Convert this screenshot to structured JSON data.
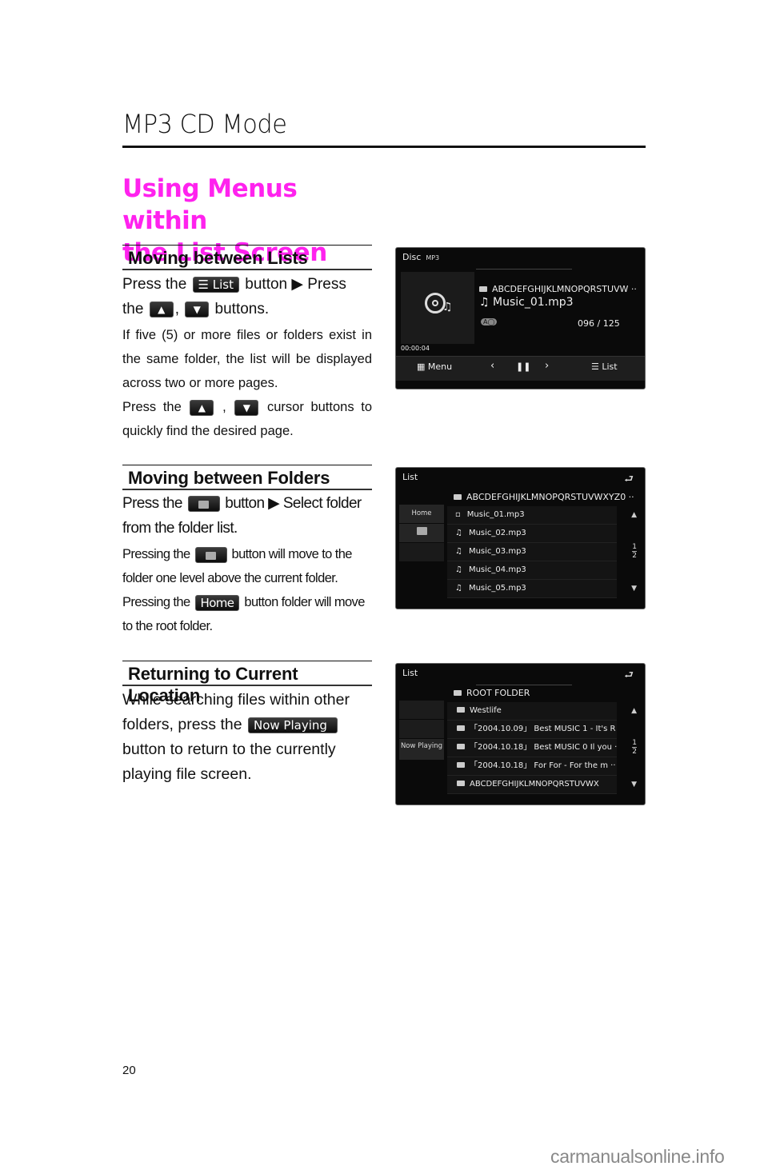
{
  "header": {
    "chapter_title": "MP3 CD Mode",
    "section_title_line1": "Using Menus within",
    "section_title_line2": "the List Screen"
  },
  "colors": {
    "section_title": "#ff22ee",
    "text": "#111111",
    "screen_bg": "#0a0a0a"
  },
  "sections": [
    {
      "heading": "Moving between Lists",
      "line1_pre": "Press the",
      "line1_button": "List",
      "line1_post": "button ▶ Press",
      "line2_pre": "the",
      "up_button": "▲",
      "down_button": "▼",
      "line2_post": "buttons.",
      "para1": "If five (5) or more files or folders exist in the same folder, the list will be displayed across two or more pages.",
      "para2_pre": "Press the",
      "para2_post": "cursor buttons to quickly find the desired page."
    },
    {
      "heading": "Moving between Folders",
      "line1_pre": "Press the",
      "line1_post": "button ▶ Select folder from the folder list.",
      "para1_pre": "Pressing the",
      "para1_post": "button will move to the folder one level above the current folder.",
      "para2_pre": "Pressing the",
      "home_button": "Home",
      "para2_post": "button folder will move to the root folder."
    },
    {
      "heading": "Returning to Current Location",
      "line1": "While searching files within other",
      "line2_pre": "folders, press the",
      "now_playing_button": "Now Playing",
      "line3": "button to return to the currently",
      "line4": "playing file screen."
    }
  ],
  "screen1": {
    "title": "Disc",
    "subtitle": "MP3",
    "folder_name": "ABCDEFGHIJKLMNOPQRSTUVW ··",
    "track": "Music_01.mp3",
    "track_count": "096 / 125",
    "elapsed": "00:00:04",
    "menu_label": "Menu",
    "list_label": "List"
  },
  "screen2": {
    "title": "List",
    "folder_name": "ABCDEFGHIJKLMNOPQRSTUVWXYZ0 ··",
    "home_label": "Home",
    "items": [
      "Music_01.mp3",
      "Music_02.mp3",
      "Music_03.mp3",
      "Music_04.mp3",
      "Music_05.mp3"
    ],
    "page_current": "1",
    "page_total": "2"
  },
  "screen3": {
    "title": "List",
    "folder_name": "ROOT FOLDER",
    "now_playing_label": "Now Playing",
    "items": [
      "Westlife",
      "「2004.10.09」 Best MUSIC 1  - It's R ··",
      "「2004.10.18」 Best MUSIC 0  Il you ··",
      "「2004.10.18」 For For  - For the m ··",
      "ABCDEFGHIJKLMNOPQRSTUVWX"
    ],
    "page_current": "1",
    "page_total": "2"
  },
  "footer": {
    "page_number": "20",
    "watermark": "carmanualsonline.info"
  }
}
